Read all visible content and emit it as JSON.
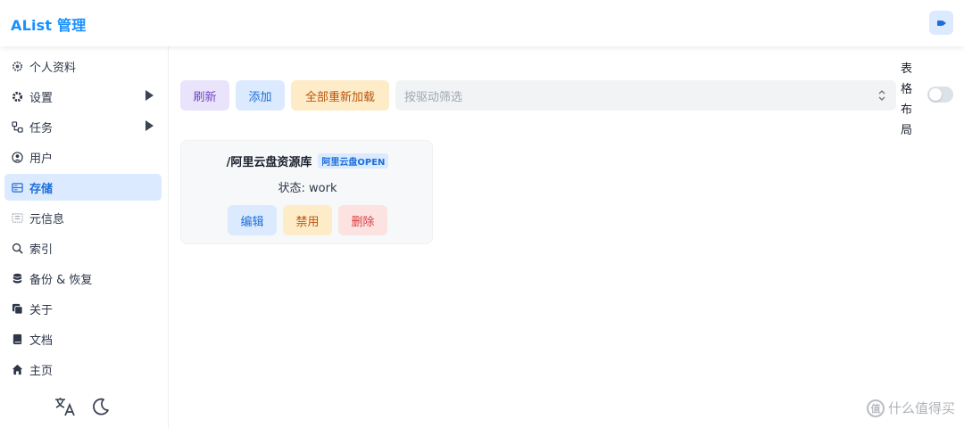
{
  "header": {
    "title": "AList 管理",
    "logout_icon": "logout-icon"
  },
  "sidebar": {
    "items": [
      {
        "label": "个人资料",
        "icon": "gear-outline-icon"
      },
      {
        "label": "设置",
        "icon": "settings-icon",
        "expandable": true
      },
      {
        "label": "任务",
        "icon": "tasks-icon",
        "expandable": true
      },
      {
        "label": "用户",
        "icon": "user-icon"
      },
      {
        "label": "存储",
        "icon": "storage-icon",
        "active": true
      },
      {
        "label": "元信息",
        "icon": "meta-icon"
      },
      {
        "label": "索引",
        "icon": "search-icon"
      },
      {
        "label": "备份 & 恢复",
        "icon": "database-icon"
      },
      {
        "label": "关于",
        "icon": "copy-icon"
      },
      {
        "label": "文档",
        "icon": "book-icon"
      },
      {
        "label": "主页",
        "icon": "home-icon"
      }
    ],
    "footer": {
      "language_icon": "translate-icon",
      "theme_icon": "moon-icon"
    }
  },
  "toolbar": {
    "refresh_label": "刷新",
    "add_label": "添加",
    "reload_all_label": "全部重新加载",
    "filter_placeholder": "按驱动筛选",
    "table_layout_label": "表格布局",
    "table_layout_enabled": false
  },
  "storages": [
    {
      "mount_path": "/阿里云盘资源库",
      "driver": "阿里云盘OPEN",
      "status": "状态: work",
      "actions": {
        "edit": "编辑",
        "disable": "禁用",
        "delete": "删除"
      }
    }
  ],
  "watermark": {
    "badge": "值",
    "text": "什么值得买"
  },
  "colors": {
    "accent": "#1890ff",
    "active_bg": "#dbeafe",
    "purple_bg": "#e9e3fb",
    "orange_bg": "#feebc8",
    "red_bg": "#fde2e2"
  }
}
